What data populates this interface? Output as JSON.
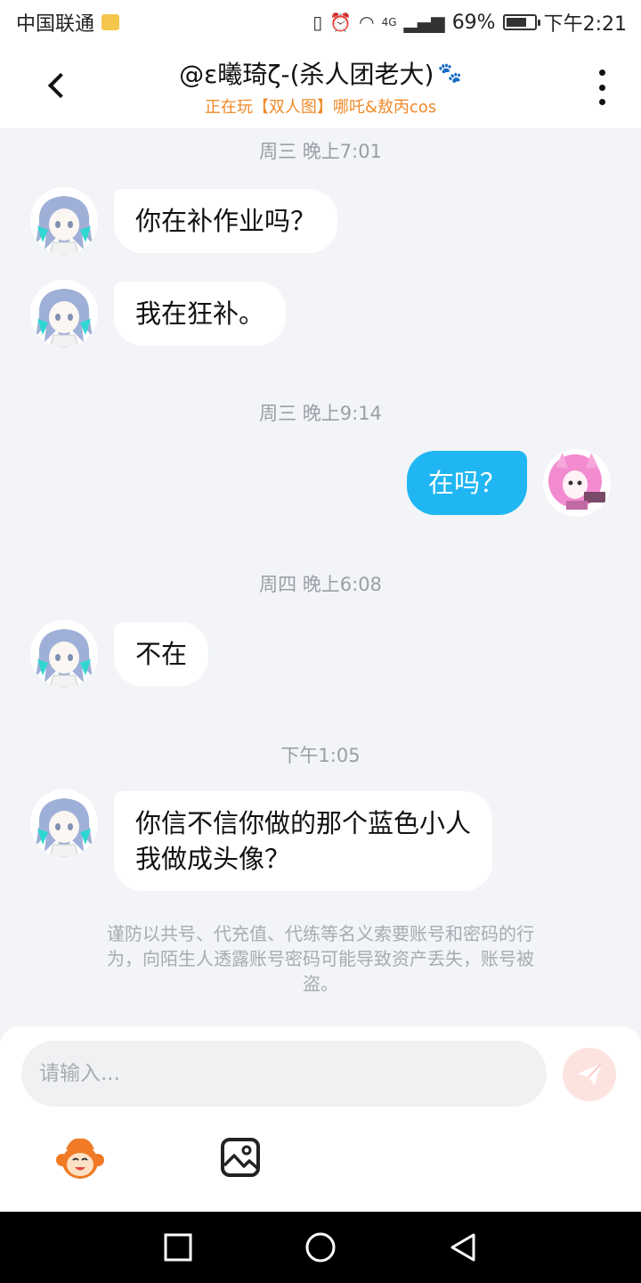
{
  "status_bar": {
    "carrier": "中国联通",
    "network": "4G",
    "battery": "69%",
    "time": "下午2:21"
  },
  "header": {
    "title": "@ɛ曦琦ζ-(杀人团老大)",
    "subtitle": "正在玩【双人图】哪吒&敖丙cos"
  },
  "messages": [
    {
      "timestamp": "周三 晚上7:01"
    },
    {
      "side": "in",
      "text": "你在补作业吗？"
    },
    {
      "side": "in",
      "text": "我在狂补。"
    },
    {
      "timestamp": "周三 晚上9:14"
    },
    {
      "side": "out",
      "text": "在吗？"
    },
    {
      "timestamp": "周四 晚上6:08"
    },
    {
      "side": "in",
      "text": "不在"
    },
    {
      "timestamp": "下午1:05"
    },
    {
      "side": "in",
      "text_line1": "你信不信你做的那个蓝色小人",
      "text_line2": "我做成头像？"
    }
  ],
  "notice": {
    "line1": "谨防以共号、代充值、代练等名义索要账号和密码的行",
    "line2": "为，向陌生人透露账号密码可能导致资产丢失，账号被",
    "line3": "盗。"
  },
  "input": {
    "placeholder": "请输入..."
  },
  "colors": {
    "outgoing_bubble": "#1fb6f3",
    "subtitle": "#f08a2a",
    "send_button": "#fde3df"
  }
}
